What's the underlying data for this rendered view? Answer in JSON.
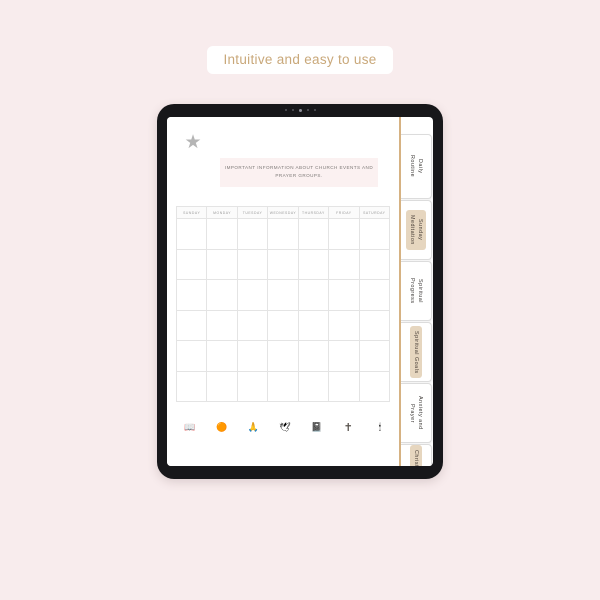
{
  "banner": {
    "text": "Intuitive and easy to use",
    "text_color": "#c9a87a",
    "pill_bg": "#ffffff"
  },
  "page_background": "#f8eced",
  "device": {
    "frame_color": "#17171a",
    "screen_bg": "#ffffff"
  },
  "planner": {
    "star_icon": "star-icon",
    "gold_rule_color": "#d6b282",
    "header_note": "IMPORTANT INFORMATION ABOUT CHURCH EVENTS AND PRAYER GROUPS.",
    "header_note_bg": "#fbf1f1",
    "calendar": {
      "day_headers": [
        "SUNDAY",
        "MONDAY",
        "TUESDAY",
        "WEDNESDAY",
        "THURSDAY",
        "FRIDAY",
        "SATURDAY"
      ],
      "rows": 6,
      "columns": 7,
      "cells": [
        [
          "",
          "",
          "",
          "",
          "",
          "",
          ""
        ],
        [
          "",
          "",
          "",
          "",
          "",
          "",
          ""
        ],
        [
          "",
          "",
          "",
          "",
          "",
          "",
          ""
        ],
        [
          "",
          "",
          "",
          "",
          "",
          "",
          ""
        ],
        [
          "",
          "",
          "",
          "",
          "",
          "",
          ""
        ],
        [
          "",
          "",
          "",
          "",
          "",
          "",
          ""
        ]
      ],
      "grid_line_color": "#e4e4e4",
      "header_bg": "#fbfbfb"
    },
    "sticker_icons": [
      {
        "name": "open-book-icon",
        "glyph": "📖"
      },
      {
        "name": "sun-icon",
        "glyph": "🟠"
      },
      {
        "name": "praying-hands-icon",
        "glyph": "🙏"
      },
      {
        "name": "dove-icon",
        "glyph": "🕊"
      },
      {
        "name": "bible-book-icon",
        "glyph": "📓"
      },
      {
        "name": "cross-icon",
        "glyph": "✝"
      },
      {
        "name": "candle-icon",
        "glyph": "🕯"
      }
    ]
  },
  "tabs": [
    {
      "label": "Daily\nRoutine",
      "highlighted": false
    },
    {
      "label": "Sunday\nMeditation",
      "highlighted": true
    },
    {
      "label": "Spiritual\nProgress",
      "highlighted": false
    },
    {
      "label": "Spiritual Goals",
      "highlighted": true
    },
    {
      "label": "Anxiety and\nPrayer",
      "highlighted": false
    },
    {
      "label": "Christian Events",
      "highlighted": true
    }
  ],
  "tab_highlight_color": "#e6d6bf"
}
